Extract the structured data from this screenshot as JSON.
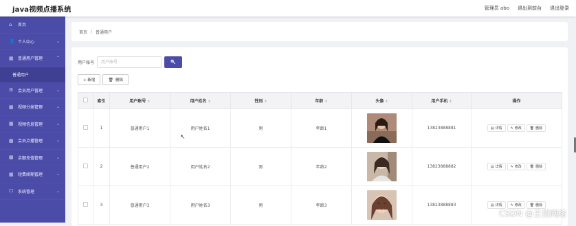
{
  "header": {
    "app_title": "java视频点播系统",
    "admin_label": "管理员 abo",
    "back_frontend": "退出到前台",
    "logout": "退出登录"
  },
  "sidebar": {
    "items": [
      {
        "label": "首页",
        "icon": "home-icon",
        "glyph": "⌂",
        "chevron": ""
      },
      {
        "label": "个人中心",
        "icon": "user-icon",
        "glyph": "👤",
        "chevron": "⌄"
      },
      {
        "label": "普通用户管理",
        "icon": "grid-icon",
        "glyph": "▦",
        "chevron": "⌃"
      },
      {
        "label": "普通用户",
        "sub": true
      },
      {
        "label": "会员用户管理",
        "icon": "gear-icon",
        "glyph": "⚙",
        "chevron": "⌄"
      },
      {
        "label": "视频分类管理",
        "icon": "grid-icon",
        "glyph": "▦",
        "chevron": "⌄"
      },
      {
        "label": "视频信息管理",
        "icon": "grid-icon",
        "glyph": "▦",
        "chevron": "⌄"
      },
      {
        "label": "会员点播管理",
        "icon": "grid-icon",
        "glyph": "▦",
        "chevron": "⌄"
      },
      {
        "label": "余额充值管理",
        "icon": "grid-icon",
        "glyph": "▦",
        "chevron": "⌄"
      },
      {
        "label": "短费续期管理",
        "icon": "grid-icon",
        "glyph": "▦",
        "chevron": "⌄"
      },
      {
        "label": "系统管理",
        "icon": "box-icon",
        "glyph": "☐",
        "chevron": "⌄"
      }
    ]
  },
  "breadcrumb": {
    "home": "首页",
    "sep": "/",
    "current": "普通用户"
  },
  "search": {
    "label": "用户账号",
    "placeholder": "用户账号",
    "button_icon": "🔍"
  },
  "actions": {
    "add": "+ 新增",
    "delete_icon": "🗑",
    "delete": "删除"
  },
  "table": {
    "columns": [
      "索引",
      "用户账号",
      "用户姓名",
      "性别",
      "年龄",
      "头像",
      "用户手机",
      "操作"
    ],
    "rows": [
      {
        "index": "1",
        "account": "普通用户1",
        "name": "用户姓名1",
        "gender": "男",
        "age": "年龄1",
        "phone": "13823888881"
      },
      {
        "index": "2",
        "account": "普通用户2",
        "name": "用户姓名2",
        "gender": "男",
        "age": "年龄2",
        "phone": "13823888882"
      },
      {
        "index": "3",
        "account": "普通用户3",
        "name": "用户姓名3",
        "gender": "男",
        "age": "年龄3",
        "phone": "13823888883"
      }
    ],
    "ops": {
      "detail": "详情",
      "edit": "修改",
      "delete": "删除"
    }
  },
  "watermark": "CSDN @王倩网络",
  "colors": {
    "sidebar": "#4b4ba8",
    "accent": "#4b4ba8"
  }
}
